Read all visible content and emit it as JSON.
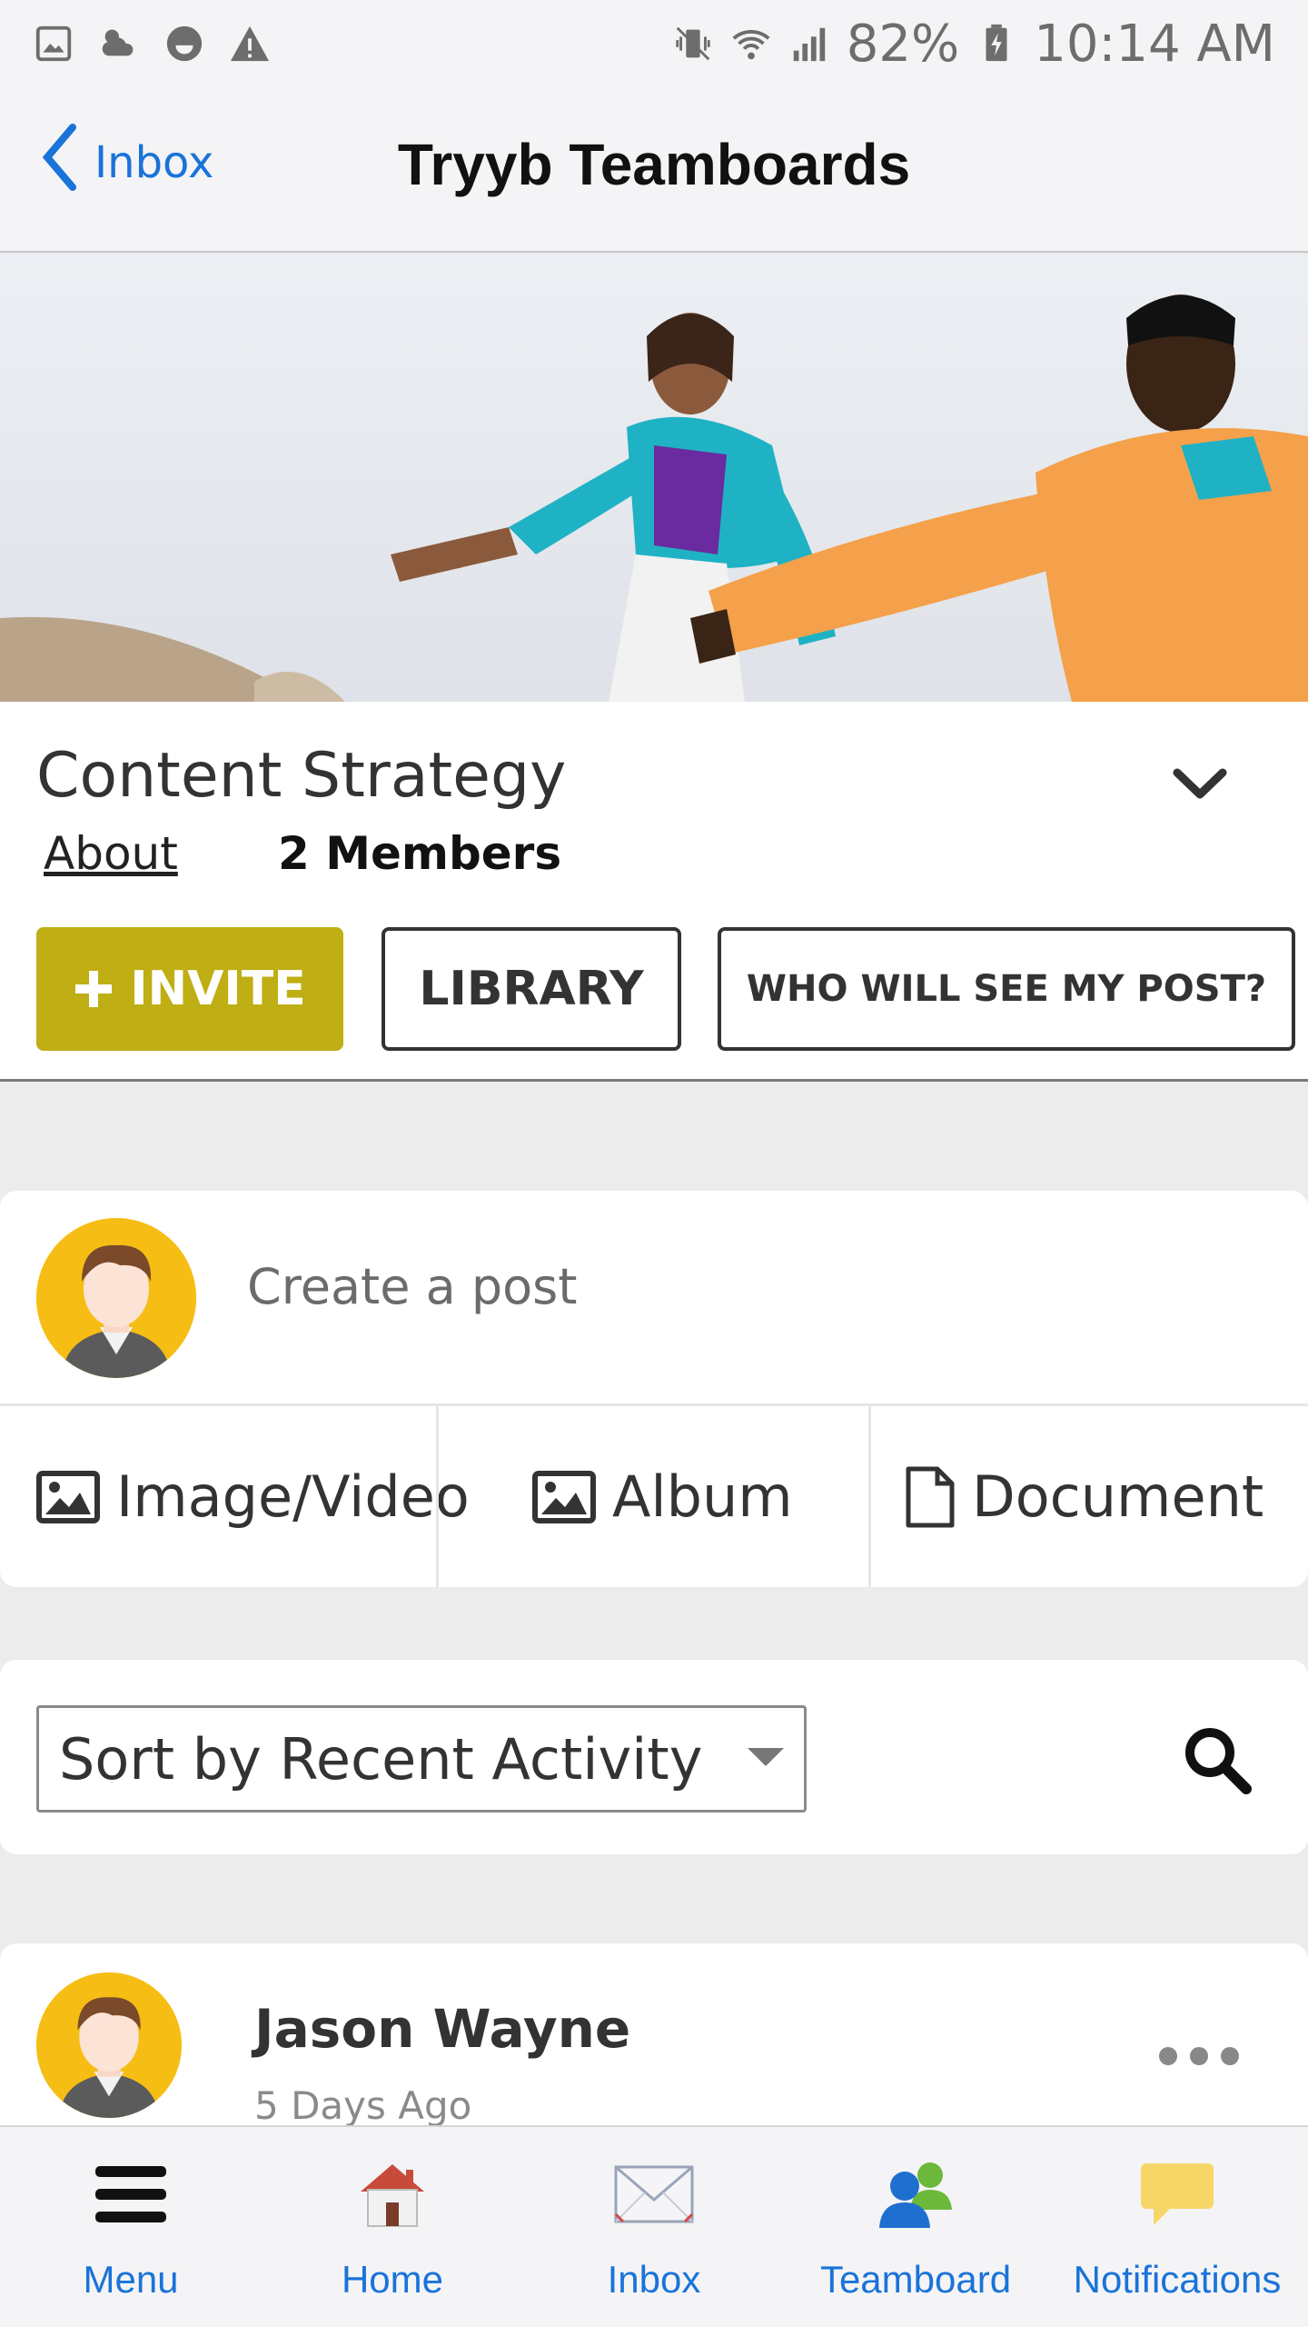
{
  "status_bar": {
    "battery": "82%",
    "time": "10:14 AM",
    "icons": [
      "gallery-icon",
      "weather-icon",
      "smiley-icon",
      "warning-icon",
      "vibrate-icon",
      "wifi-icon",
      "signal-icon",
      "battery-charging-icon"
    ]
  },
  "nav": {
    "back_label": "Inbox",
    "title": "Tryyb Teamboards"
  },
  "group": {
    "title": "Content Strategy",
    "about_link": "About",
    "members": "2 Members",
    "invite_label": "INVITE",
    "library_label": "LIBRARY",
    "who_label": "WHO WILL SEE MY POST?",
    "accent_color": "#bfae14"
  },
  "composer": {
    "placeholder": "Create a post",
    "attachments": [
      {
        "label": "Image/Video",
        "icon": "image-icon"
      },
      {
        "label": "Album",
        "icon": "image-icon"
      },
      {
        "label": "Document",
        "icon": "document-icon"
      }
    ]
  },
  "sort": {
    "selected": "Sort by Recent Activity"
  },
  "post": {
    "author": "Jason Wayne",
    "time": "5 Days Ago"
  },
  "tabbar": {
    "items": [
      {
        "label": "Menu",
        "icon": "hamburger-icon"
      },
      {
        "label": "Home",
        "icon": "house-icon"
      },
      {
        "label": "Inbox",
        "icon": "envelope-icon"
      },
      {
        "label": "Teamboard",
        "icon": "people-icon"
      },
      {
        "label": "Notifications",
        "icon": "speech-bubble-icon"
      }
    ],
    "tint_color": "#1a73d9"
  }
}
